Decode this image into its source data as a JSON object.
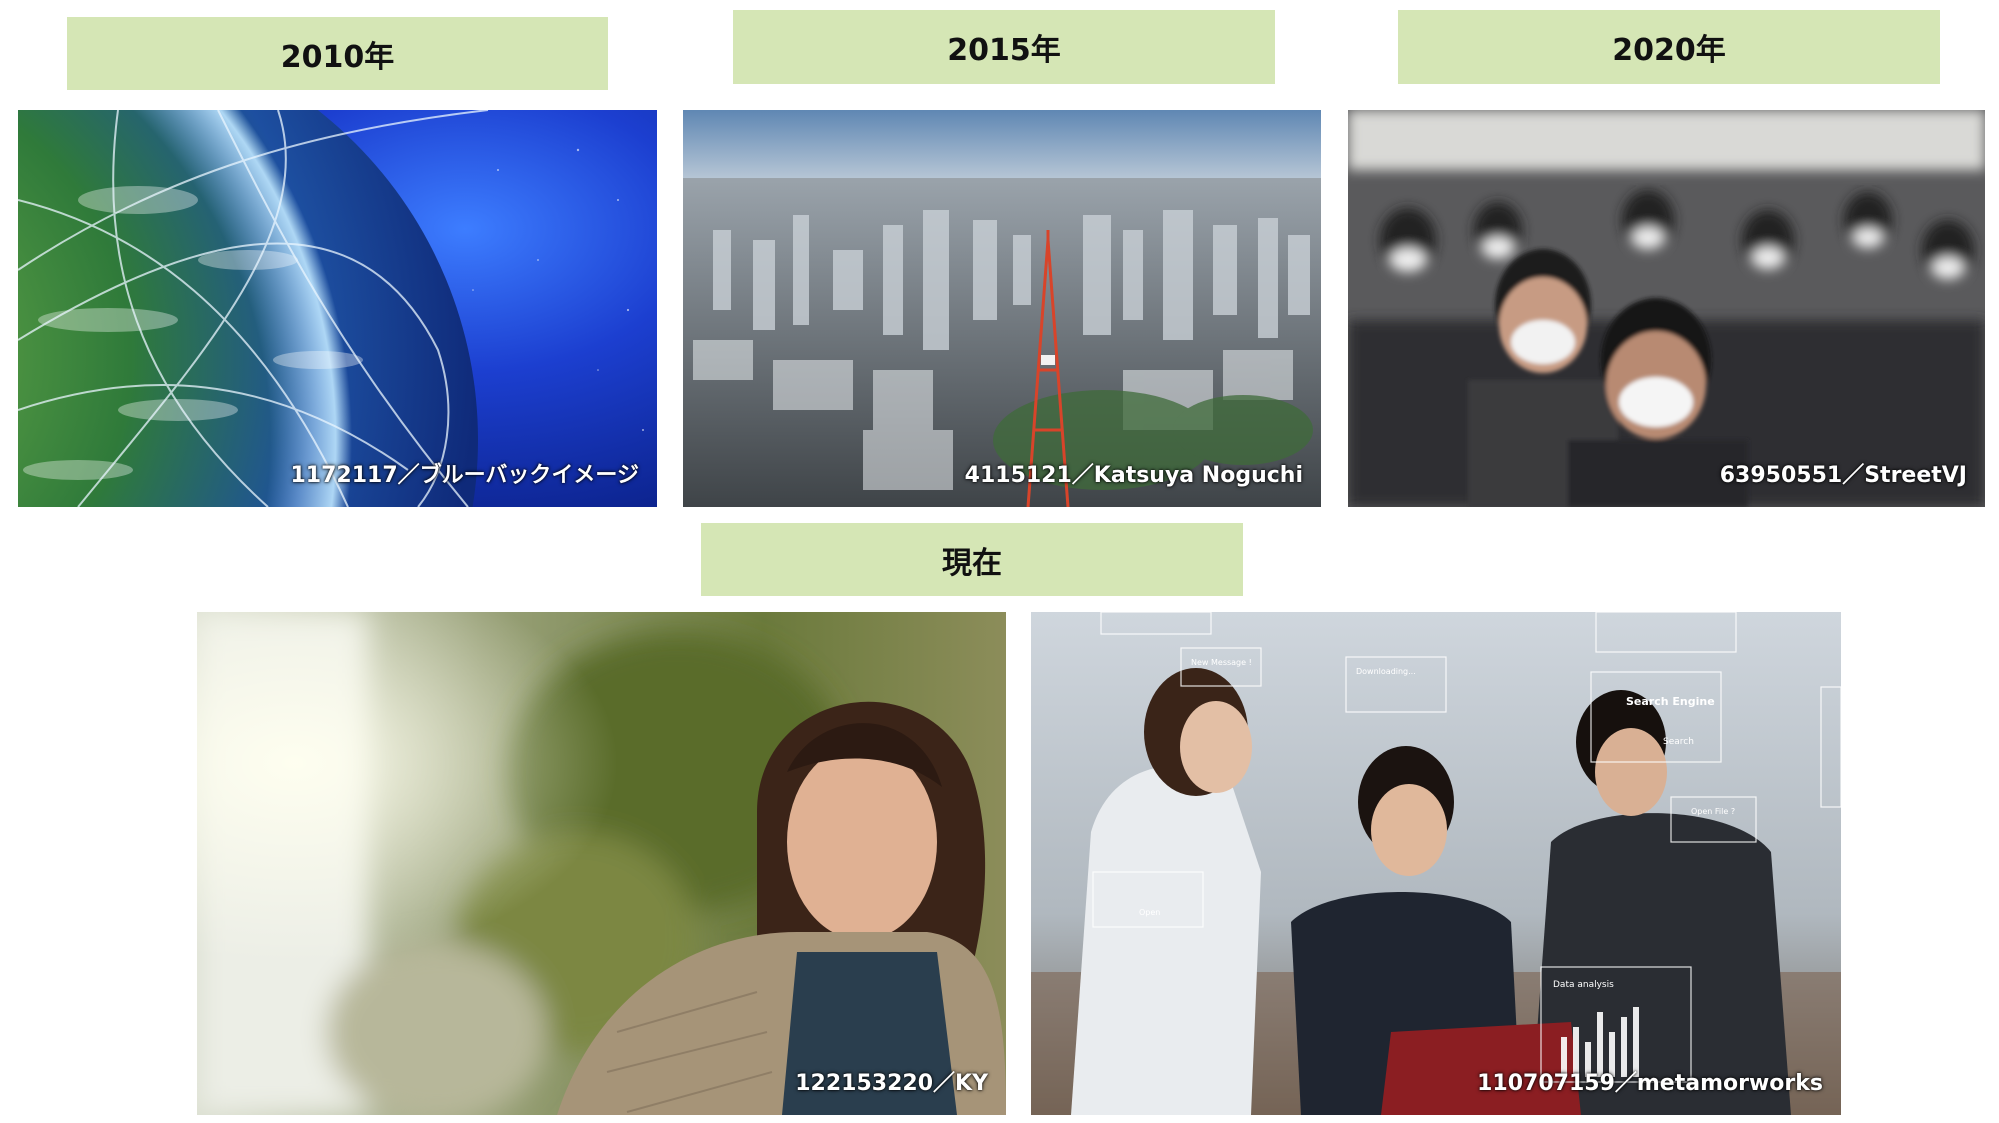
{
  "panels": {
    "p2010": {
      "label": "2010年",
      "caption": "1172117／ブルーバックイメージ"
    },
    "p2015": {
      "label": "2015年",
      "caption": "4115121／Katsuya Noguchi"
    },
    "p2020": {
      "label": "2020年",
      "caption": "63950551／StreetVJ"
    },
    "now": {
      "label": "現在",
      "left_caption": "122153220／KY",
      "right_caption": "110707159／metamorworks",
      "ui_overlay": {
        "search_engine": "Search Engine",
        "search_button": "Search",
        "new_message": "New Message !",
        "open_button": "Open",
        "downloading": "Downloading...",
        "open_file": "Open File ?",
        "data_analysis": "Data analysis"
      }
    }
  },
  "colors": {
    "label_bg": "#d5e6b5"
  }
}
